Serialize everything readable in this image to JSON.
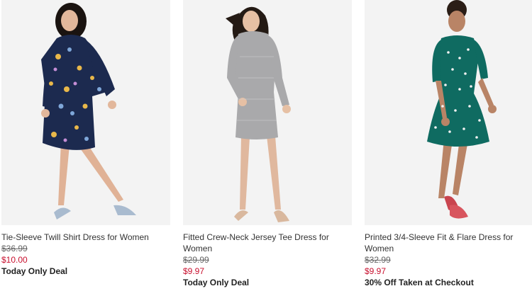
{
  "products": [
    {
      "name": "Tie-Sleeve Twill Shirt Dress for Women",
      "was_price": "$36.99",
      "sale_price": "$10.00",
      "promo": "Today Only Deal",
      "dress_color": "#1c2a4f",
      "print_color": "#e9b84a"
    },
    {
      "name": "Fitted Crew-Neck Jersey Tee Dress for Women",
      "was_price": "$29.99",
      "sale_price": "$9.97",
      "promo": "Today Only Deal",
      "dress_color": "#a9a9ab",
      "print_color": "#cfcfd1"
    },
    {
      "name": "Printed 3/4-Sleeve Fit & Flare Dress for Women",
      "was_price": "$32.99",
      "sale_price": "$9.97",
      "promo": "30% Off Taken at Checkout",
      "dress_color": "#0f6b61",
      "print_color": "#f2f2f2"
    }
  ],
  "colors": {
    "sale": "#c8102e",
    "image_bg": "#f3f3f3"
  }
}
